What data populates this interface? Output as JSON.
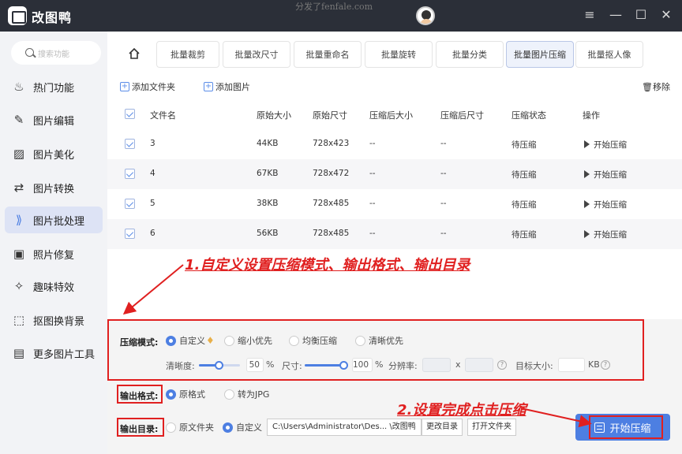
{
  "app": {
    "name": "改图鸭",
    "watermark": "分发了fenfale.com"
  },
  "window": {
    "menu_glyph": "≡",
    "min_glyph": "—",
    "max_glyph": "☐",
    "close_glyph": "✕"
  },
  "sidebar": {
    "search_placeholder": "搜索功能",
    "items": [
      {
        "label": "热门功能",
        "icon": "flame-icon",
        "glyph": "♨"
      },
      {
        "label": "图片编辑",
        "icon": "edit-icon",
        "glyph": "✎"
      },
      {
        "label": "图片美化",
        "icon": "image-icon",
        "glyph": "▨"
      },
      {
        "label": "图片转换",
        "icon": "convert-icon",
        "glyph": "⇄"
      },
      {
        "label": "图片批处理",
        "icon": "batch-icon",
        "glyph": "⟫"
      },
      {
        "label": "照片修复",
        "icon": "photo-repair-icon",
        "glyph": "▣"
      },
      {
        "label": "趣味特效",
        "icon": "sparkle-icon",
        "glyph": "✧"
      },
      {
        "label": "抠图换背景",
        "icon": "cutout-icon",
        "glyph": "⬚"
      },
      {
        "label": "更多图片工具",
        "icon": "toolbox-icon",
        "glyph": "▤"
      }
    ],
    "active_index": 4
  },
  "tabs": [
    "批量裁剪",
    "批量改尺寸",
    "批量重命名",
    "批量旋转",
    "批量分类",
    "批量图片压缩",
    "批量抠人像"
  ],
  "active_tab": 5,
  "toolbar": {
    "add_folder": "添加文件夹",
    "add_image": "添加图片",
    "remove": "移除"
  },
  "table": {
    "columns": [
      "文件名",
      "原始大小",
      "原始尺寸",
      "压缩后大小",
      "压缩后尺寸",
      "压缩状态",
      "操作"
    ],
    "rows": [
      {
        "name": "3",
        "size": "44KB",
        "dims": "728x423",
        "csize": "--",
        "cdims": "--",
        "status": "待压缩",
        "action": "开始压缩"
      },
      {
        "name": "4",
        "size": "67KB",
        "dims": "728x472",
        "csize": "--",
        "cdims": "--",
        "status": "待压缩",
        "action": "开始压缩"
      },
      {
        "name": "5",
        "size": "38KB",
        "dims": "728x485",
        "csize": "--",
        "cdims": "--",
        "status": "待压缩",
        "action": "开始压缩"
      },
      {
        "name": "6",
        "size": "56KB",
        "dims": "728x485",
        "csize": "--",
        "cdims": "--",
        "status": "待压缩",
        "action": "开始压缩"
      }
    ]
  },
  "settings": {
    "mode_label": "压缩模式:",
    "modes": [
      "自定义",
      "缩小优先",
      "均衡压缩",
      "清晰优先"
    ],
    "mode_selected": 0,
    "clarity_label": "清晰度:",
    "clarity_value": "50",
    "size_label": "尺寸:",
    "size_value": "100",
    "percent": "%",
    "resolution_label": "分辨率:",
    "x_sep": "x",
    "target_label": "目标大小:",
    "kb_unit": "KB",
    "clarity_level": 0.5,
    "size_level": 1.0,
    "format_label": "输出格式:",
    "formats": [
      "原格式",
      "转为JPG"
    ],
    "output_label": "输出目录:",
    "outputs": [
      "原文件夹",
      "自定义"
    ],
    "output_path": "C:\\Users\\Administrator\\Des... \\改图鸭",
    "change_dir": "更改目录",
    "open_folder": "打开文件夹",
    "start": "开始压缩"
  },
  "annotations": {
    "step1": "1.自定义设置压缩模式、输出格式、输出目录",
    "step2": "2.设置完成点击压缩"
  },
  "colors": {
    "accent": "#4d7fe2",
    "titlebar": "#2b2f38",
    "annotation": "#e02020"
  }
}
